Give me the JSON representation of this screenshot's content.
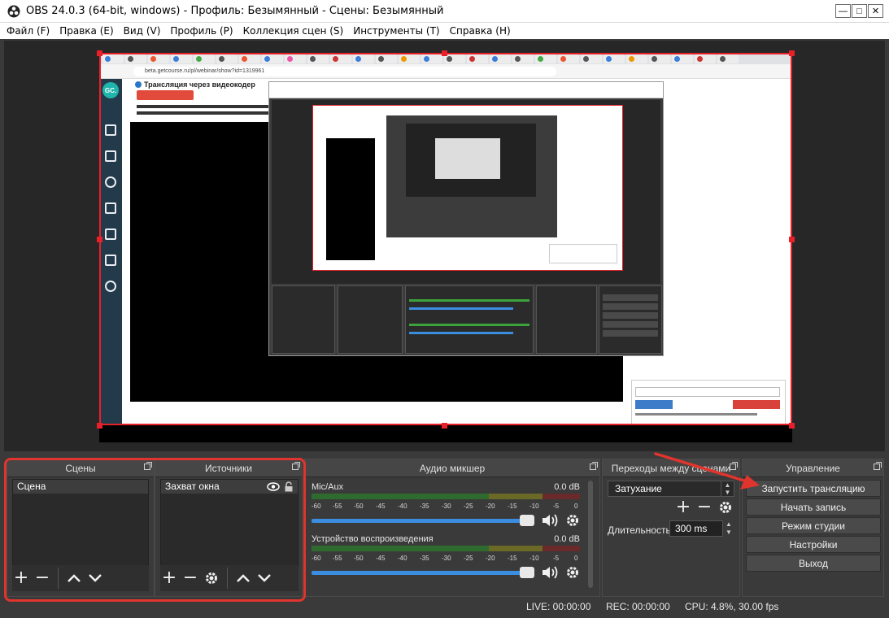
{
  "window": {
    "title": "OBS 24.0.3 (64-bit, windows) - Профиль: Безымянный - Сцены: Безымянный",
    "minimize": "—",
    "maximize": "□",
    "close": "✕"
  },
  "menu": [
    "Файл (F)",
    "Правка (E)",
    "Вид (V)",
    "Профиль (P)",
    "Коллекция сцен (S)",
    "Инструменты (T)",
    "Справка (H)"
  ],
  "preview_content": {
    "logo": "GC.",
    "page_title": "Трансляция через видеокодер",
    "url": "beta.getcourse.ru/pl/webinar/show?id=1319961"
  },
  "scenes": {
    "title": "Сцены",
    "items": [
      "Сцена"
    ]
  },
  "sources": {
    "title": "Источники",
    "items": [
      "Захват окна"
    ]
  },
  "mixer": {
    "title": "Аудио микшер",
    "ticks": [
      "-60",
      "-55",
      "-50",
      "-45",
      "-40",
      "-35",
      "-30",
      "-25",
      "-20",
      "-15",
      "-10",
      "-5",
      "0"
    ],
    "channels": [
      {
        "name": "Mic/Aux",
        "db": "0.0 dB",
        "volume_fraction": 1.0
      },
      {
        "name": "Устройство воспроизведения",
        "db": "0.0 dB",
        "volume_fraction": 1.0
      }
    ]
  },
  "transitions": {
    "title": "Переходы между сценами",
    "selected": "Затухание",
    "duration_label": "Длительность",
    "duration_value": "300 ms"
  },
  "controls": {
    "title": "Управление",
    "buttons": [
      "Запустить трансляцию",
      "Начать запись",
      "Режим студии",
      "Настройки",
      "Выход"
    ]
  },
  "status": {
    "live": "LIVE: 00:00:00",
    "rec": "REC: 00:00:00",
    "cpu": "CPU: 4.8%, 30.00 fps"
  },
  "colors": {
    "accent_red": "#e0342e",
    "volume_blue": "#3b8de0",
    "panel_bg": "#3a3a3a"
  }
}
